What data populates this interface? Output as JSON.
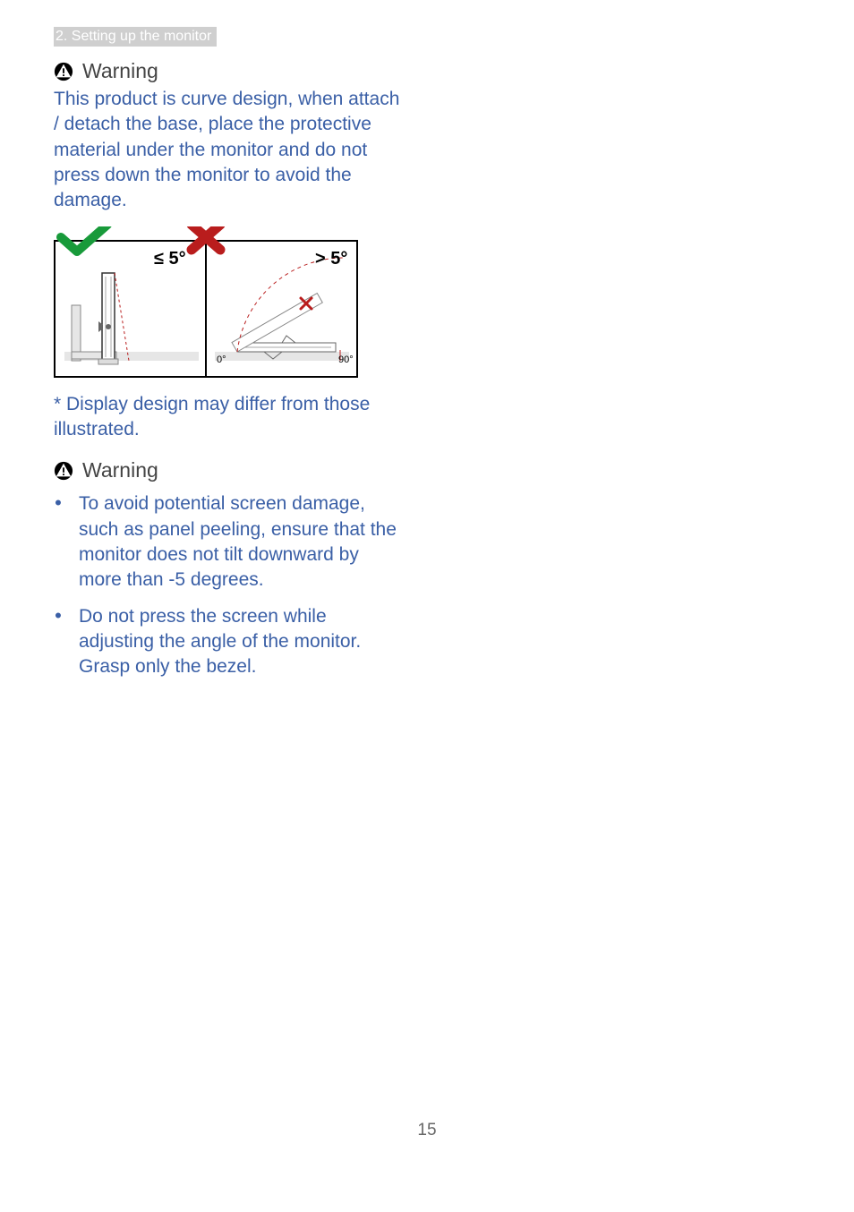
{
  "header": {
    "section_label": "2. Setting up the monitor"
  },
  "warning1": {
    "title": "Warning",
    "body": "This product is curve design, when attach / detach the base, place the protective material under the monitor and do not press down the monitor to avoid the damage."
  },
  "diagram": {
    "ok_label": "≤ 5°",
    "bad_label": "> 5°",
    "zero_label": "0°",
    "ninety_label": "90°",
    "check_icon": "check-icon",
    "cross_icon": "cross-icon"
  },
  "footnote": "* Display design may differ from those illustrated.",
  "warning2": {
    "title": "Warning",
    "bullets": [
      "To avoid potential screen damage, such as panel peeling, ensure that the monitor does not tilt downward by more than -5 degrees.",
      "Do not press the screen while adjusting the angle of the monitor. Grasp only the bezel."
    ]
  },
  "page_number": "15"
}
